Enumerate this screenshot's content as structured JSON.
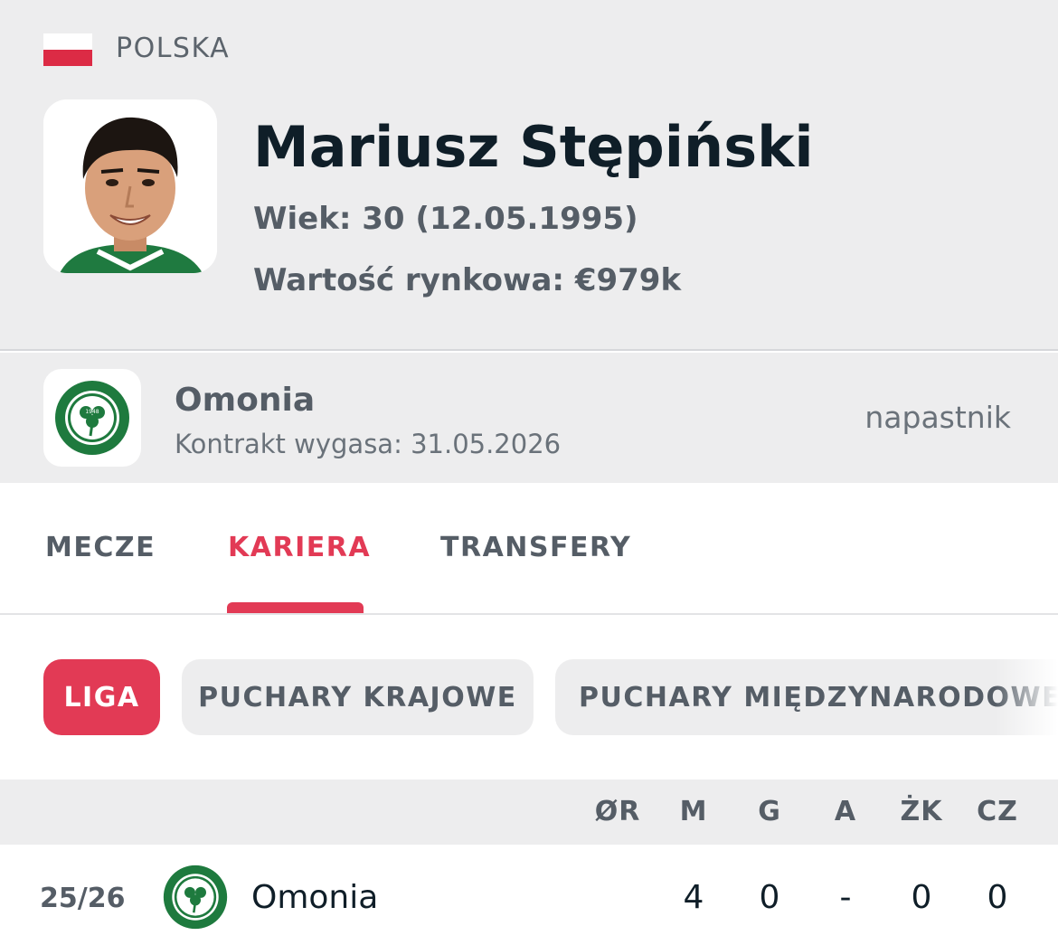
{
  "player": {
    "country": "POLSKA",
    "name": "Mariusz Stępiński",
    "age_line": "Wiek: 30 (12.05.1995)",
    "value_line": "Wartość rynkowa: €979k"
  },
  "club": {
    "name": "Omonia",
    "contract": "Kontrakt wygasa: 31.05.2026",
    "position": "napastnik",
    "badge_year": "1948"
  },
  "tabs": [
    {
      "label": "MECZE"
    },
    {
      "label": "KARIERA"
    },
    {
      "label": "TRANSFERY"
    }
  ],
  "filters": [
    {
      "label": "LIGA"
    },
    {
      "label": "PUCHARY KRAJOWE"
    },
    {
      "label": "PUCHARY MIĘDZYNARODOWE"
    }
  ],
  "table": {
    "columns": [
      "ØR",
      "M",
      "G",
      "A",
      "ŻK",
      "CZ"
    ],
    "rows": [
      {
        "season": "25/26",
        "club": "Omonia",
        "values": [
          "",
          "4",
          "0",
          "-",
          "0",
          "0"
        ]
      }
    ]
  },
  "colors": {
    "accent": "#e23a55",
    "flag_red": "#dc2b45",
    "club_green": "#1e7a3e"
  },
  "icons": {
    "flag": "poland-flag-icon",
    "club": "omonia-crest-icon"
  }
}
